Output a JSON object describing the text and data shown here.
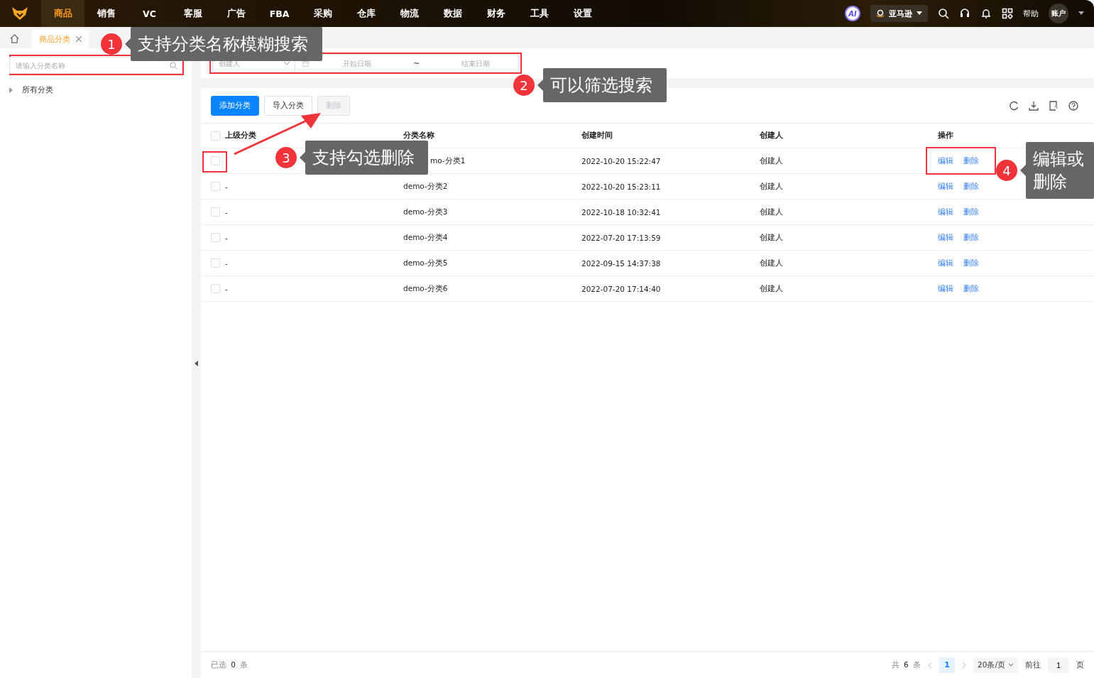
{
  "nav": {
    "items": [
      {
        "label": "商品",
        "selected": true
      },
      {
        "label": "销售",
        "selected": false
      },
      {
        "label": "VC",
        "selected": false
      },
      {
        "label": "客服",
        "selected": false
      },
      {
        "label": "广告",
        "selected": false
      },
      {
        "label": "FBA",
        "selected": false
      },
      {
        "label": "采购",
        "selected": false
      },
      {
        "label": "仓库",
        "selected": false
      },
      {
        "label": "物流",
        "selected": false
      },
      {
        "label": "数据",
        "selected": false
      },
      {
        "label": "财务",
        "selected": false
      },
      {
        "label": "工具",
        "selected": false
      },
      {
        "label": "设置",
        "selected": false
      }
    ],
    "ai": "AI",
    "store": "亚马逊",
    "help": "帮助",
    "account": "账户"
  },
  "page_tabs": [
    {
      "label": "商品分类",
      "selected": true
    }
  ],
  "sidebar": {
    "search": {
      "placeholder": "请输入分类名称"
    },
    "tree": [
      {
        "label": "所有分类",
        "expanded": false
      }
    ]
  },
  "filters": {
    "creator": {
      "placeholder": "创建人"
    },
    "start": {
      "placeholder": "开始日期"
    },
    "separator": "~",
    "end": {
      "placeholder": "结束日期"
    }
  },
  "toolbar": {
    "buttons": [
      {
        "label": "添加分类",
        "kind": "primary",
        "disabled": false
      },
      {
        "label": "导入分类",
        "kind": "default",
        "disabled": false
      },
      {
        "label": "删除",
        "kind": "default",
        "disabled": true
      }
    ]
  },
  "table": {
    "columns": [
      "上级分类",
      "分类名称",
      "创建时间",
      "创建人",
      "操作"
    ],
    "header_checked": false,
    "rows": [
      {
        "checked": false,
        "parent": "",
        "name": "mo-分类1",
        "name_covered": true,
        "time": "2022-10-20 15:22:47",
        "creator": "创建人",
        "actions": [
          "编辑",
          "删除"
        ]
      },
      {
        "checked": false,
        "parent": "-",
        "name": "demo-分类2",
        "name_covered": false,
        "time": "2022-10-20 15:23:11",
        "creator": "创建人",
        "actions": [
          "编辑",
          "删除"
        ]
      },
      {
        "checked": false,
        "parent": "-",
        "name": "demo-分类3",
        "name_covered": false,
        "time": "2022-10-18 10:32:41",
        "creator": "创建人",
        "actions": [
          "编辑",
          "删除"
        ]
      },
      {
        "checked": false,
        "parent": "-",
        "name": "demo-分类4",
        "name_covered": false,
        "time": "2022-07-20 17:13:59",
        "creator": "创建人",
        "actions": [
          "编辑",
          "删除"
        ]
      },
      {
        "checked": false,
        "parent": "-",
        "name": "demo-分类5",
        "name_covered": false,
        "time": "2022-09-15 14:37:38",
        "creator": "创建人",
        "actions": [
          "编辑",
          "删除"
        ]
      },
      {
        "checked": false,
        "parent": "-",
        "name": "demo-分类6",
        "name_covered": false,
        "time": "2022-07-20 17:14:40",
        "creator": "创建人",
        "actions": [
          "编辑",
          "删除"
        ]
      }
    ]
  },
  "footer": {
    "selected": "已选 **0** 条",
    "total": "共 **6** 条",
    "pages": [
      {
        "label": "1",
        "selected": true
      }
    ],
    "page_size": "20条/页",
    "goto": "前往",
    "goto_value": "1",
    "page_unit": "页"
  },
  "callouts": [
    {
      "number": "1",
      "text": "支持分类名称模糊搜索"
    },
    {
      "number": "2",
      "text": "可以筛选搜索"
    },
    {
      "number": "3",
      "text": "支持勾选删除"
    },
    {
      "number": "4",
      "text": "编辑或删除"
    }
  ]
}
